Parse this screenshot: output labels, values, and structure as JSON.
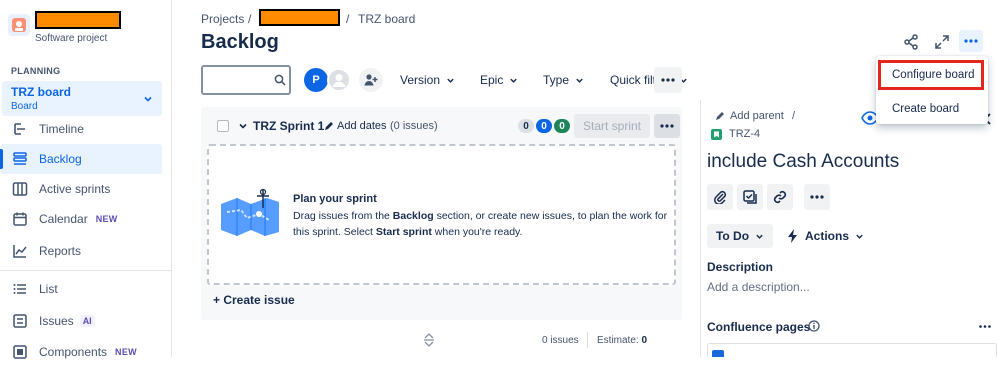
{
  "sidebar": {
    "project_type": "Software project",
    "section_planning": "PLANNING",
    "board": {
      "name": "TRZ board",
      "type": "Board"
    },
    "items": [
      {
        "label": "Timeline",
        "icon": "timeline-icon",
        "active": false
      },
      {
        "label": "Backlog",
        "icon": "backlog-icon",
        "active": true
      },
      {
        "label": "Active sprints",
        "icon": "board-columns-icon",
        "active": false
      },
      {
        "label": "Calendar",
        "icon": "calendar-icon",
        "badge": "NEW",
        "active": false
      },
      {
        "label": "Reports",
        "icon": "chart-line-icon",
        "active": false
      },
      {
        "label": "List",
        "icon": "list-icon",
        "active": false
      },
      {
        "label": "Issues",
        "icon": "issues-icon",
        "badge": "AI",
        "active": false
      },
      {
        "label": "Components",
        "icon": "components-icon",
        "badge": "NEW",
        "active": false
      }
    ]
  },
  "header": {
    "breadcrumb": [
      "Projects",
      "TRZ board"
    ],
    "separator": "/",
    "title": "Backlog",
    "avatar_initial": "P",
    "filters": [
      "Version",
      "Epic",
      "Type",
      "Quick filters"
    ]
  },
  "sprint": {
    "name": "TRZ Sprint 1",
    "add_dates": "Add dates",
    "issue_count": "(0 issues)",
    "counts": [
      "0",
      "0",
      "0"
    ],
    "start_button": "Start sprint",
    "empty_title": "Plan your sprint",
    "empty_desc_1": "Drag issues from the ",
    "empty_desc_bold_1": "Backlog",
    "empty_desc_2": " section, or create new issues, to plan the work for this sprint. Select ",
    "empty_desc_bold_2": "Start sprint",
    "empty_desc_3": " when you're ready.",
    "create_issue": "+ Create issue",
    "footer_issues": "0 issues",
    "footer_estimate_label": "Estimate:",
    "footer_estimate_value": "0"
  },
  "issue_panel": {
    "add_parent": "Add parent",
    "separator": "/",
    "key": "TRZ-4",
    "title": "include Cash Accounts",
    "status": "To Do",
    "actions": "Actions",
    "description_label": "Description",
    "description_placeholder": "Add a description...",
    "confluence_label": "Confluence pages"
  },
  "menu": {
    "items": [
      "Configure board",
      "Create board"
    ]
  },
  "colors": {
    "accent": "#0c66e4",
    "redaction": "#ff8b00",
    "menu_highlight": "#e3261b"
  }
}
